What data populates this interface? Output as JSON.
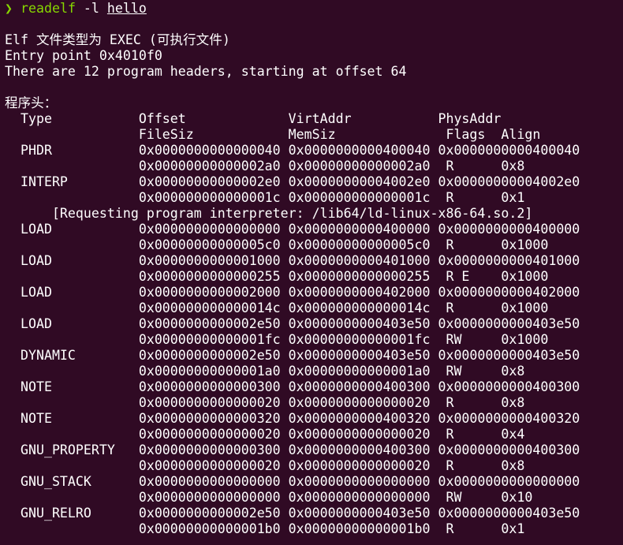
{
  "prompt": {
    "arrow": "❯",
    "command": "readelf",
    "flag": " -l ",
    "argument": "hello"
  },
  "output": {
    "elf_type": "Elf 文件类型为 EXEC (可执行文件)",
    "entry_point": "Entry point 0x4010f0",
    "summary": "There are 12 program headers, starting at offset 64",
    "section_title": "程序头：",
    "header1": "  Type           Offset             VirtAddr           PhysAddr",
    "header2": "                 FileSiz            MemSiz              Flags  Align",
    "rows": [
      "  PHDR           0x0000000000000040 0x0000000000400040 0x0000000000400040",
      "                 0x00000000000002a0 0x00000000000002a0  R      0x8",
      "  INTERP         0x00000000000002e0 0x00000000004002e0 0x00000000004002e0",
      "                 0x000000000000001c 0x000000000000001c  R      0x1",
      "      [Requesting program interpreter: /lib64/ld-linux-x86-64.so.2]",
      "  LOAD           0x0000000000000000 0x0000000000400000 0x0000000000400000",
      "                 0x00000000000005c0 0x00000000000005c0  R      0x1000",
      "  LOAD           0x0000000000001000 0x0000000000401000 0x0000000000401000",
      "                 0x0000000000000255 0x0000000000000255  R E    0x1000",
      "  LOAD           0x0000000000002000 0x0000000000402000 0x0000000000402000",
      "                 0x000000000000014c 0x000000000000014c  R      0x1000",
      "  LOAD           0x0000000000002e50 0x0000000000403e50 0x0000000000403e50",
      "                 0x00000000000001fc 0x00000000000001fc  RW     0x1000",
      "  DYNAMIC        0x0000000000002e50 0x0000000000403e50 0x0000000000403e50",
      "                 0x00000000000001a0 0x00000000000001a0  RW     0x8",
      "  NOTE           0x0000000000000300 0x0000000000400300 0x0000000000400300",
      "                 0x0000000000000020 0x0000000000000020  R      0x8",
      "  NOTE           0x0000000000000320 0x0000000000400320 0x0000000000400320",
      "                 0x0000000000000020 0x0000000000000020  R      0x4",
      "  GNU_PROPERTY   0x0000000000000300 0x0000000000400300 0x0000000000400300",
      "                 0x0000000000000020 0x0000000000000020  R      0x8",
      "  GNU_STACK      0x0000000000000000 0x0000000000000000 0x0000000000000000",
      "                 0x0000000000000000 0x0000000000000000  RW     0x10",
      "  GNU_RELRO      0x0000000000002e50 0x0000000000403e50 0x0000000000403e50",
      "                 0x00000000000001b0 0x00000000000001b0  R      0x1"
    ]
  },
  "colors": {
    "background": "#300a24",
    "text": "#ffffff",
    "prompt": "#87d700"
  }
}
